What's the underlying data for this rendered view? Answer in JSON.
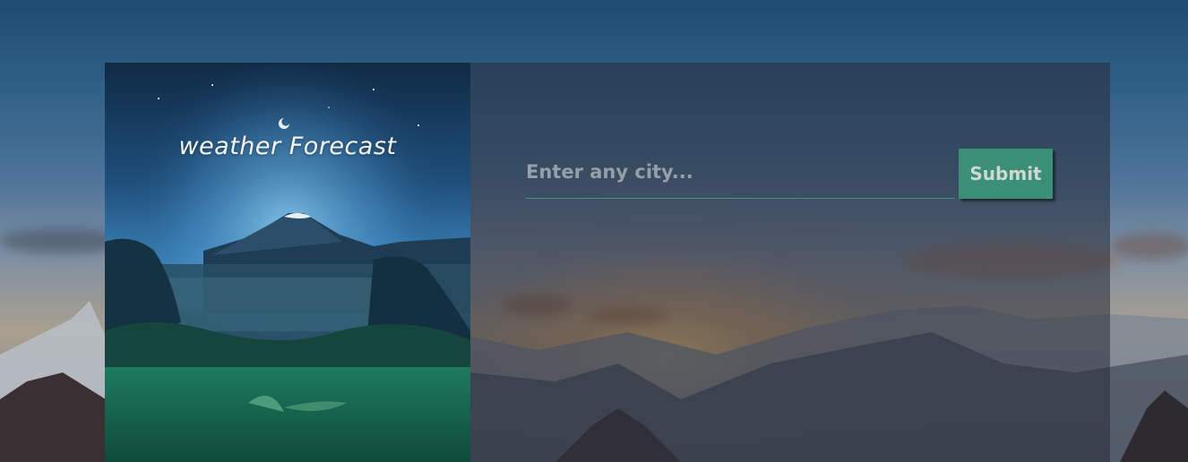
{
  "poster": {
    "title": "weather Forecast"
  },
  "search": {
    "placeholder": "Enter any city...",
    "value": ""
  },
  "submit": {
    "label": "Submit"
  },
  "colors": {
    "accent": "#3a8f74",
    "underline": "#3d9a7c",
    "panel_overlay": "#282c38"
  }
}
